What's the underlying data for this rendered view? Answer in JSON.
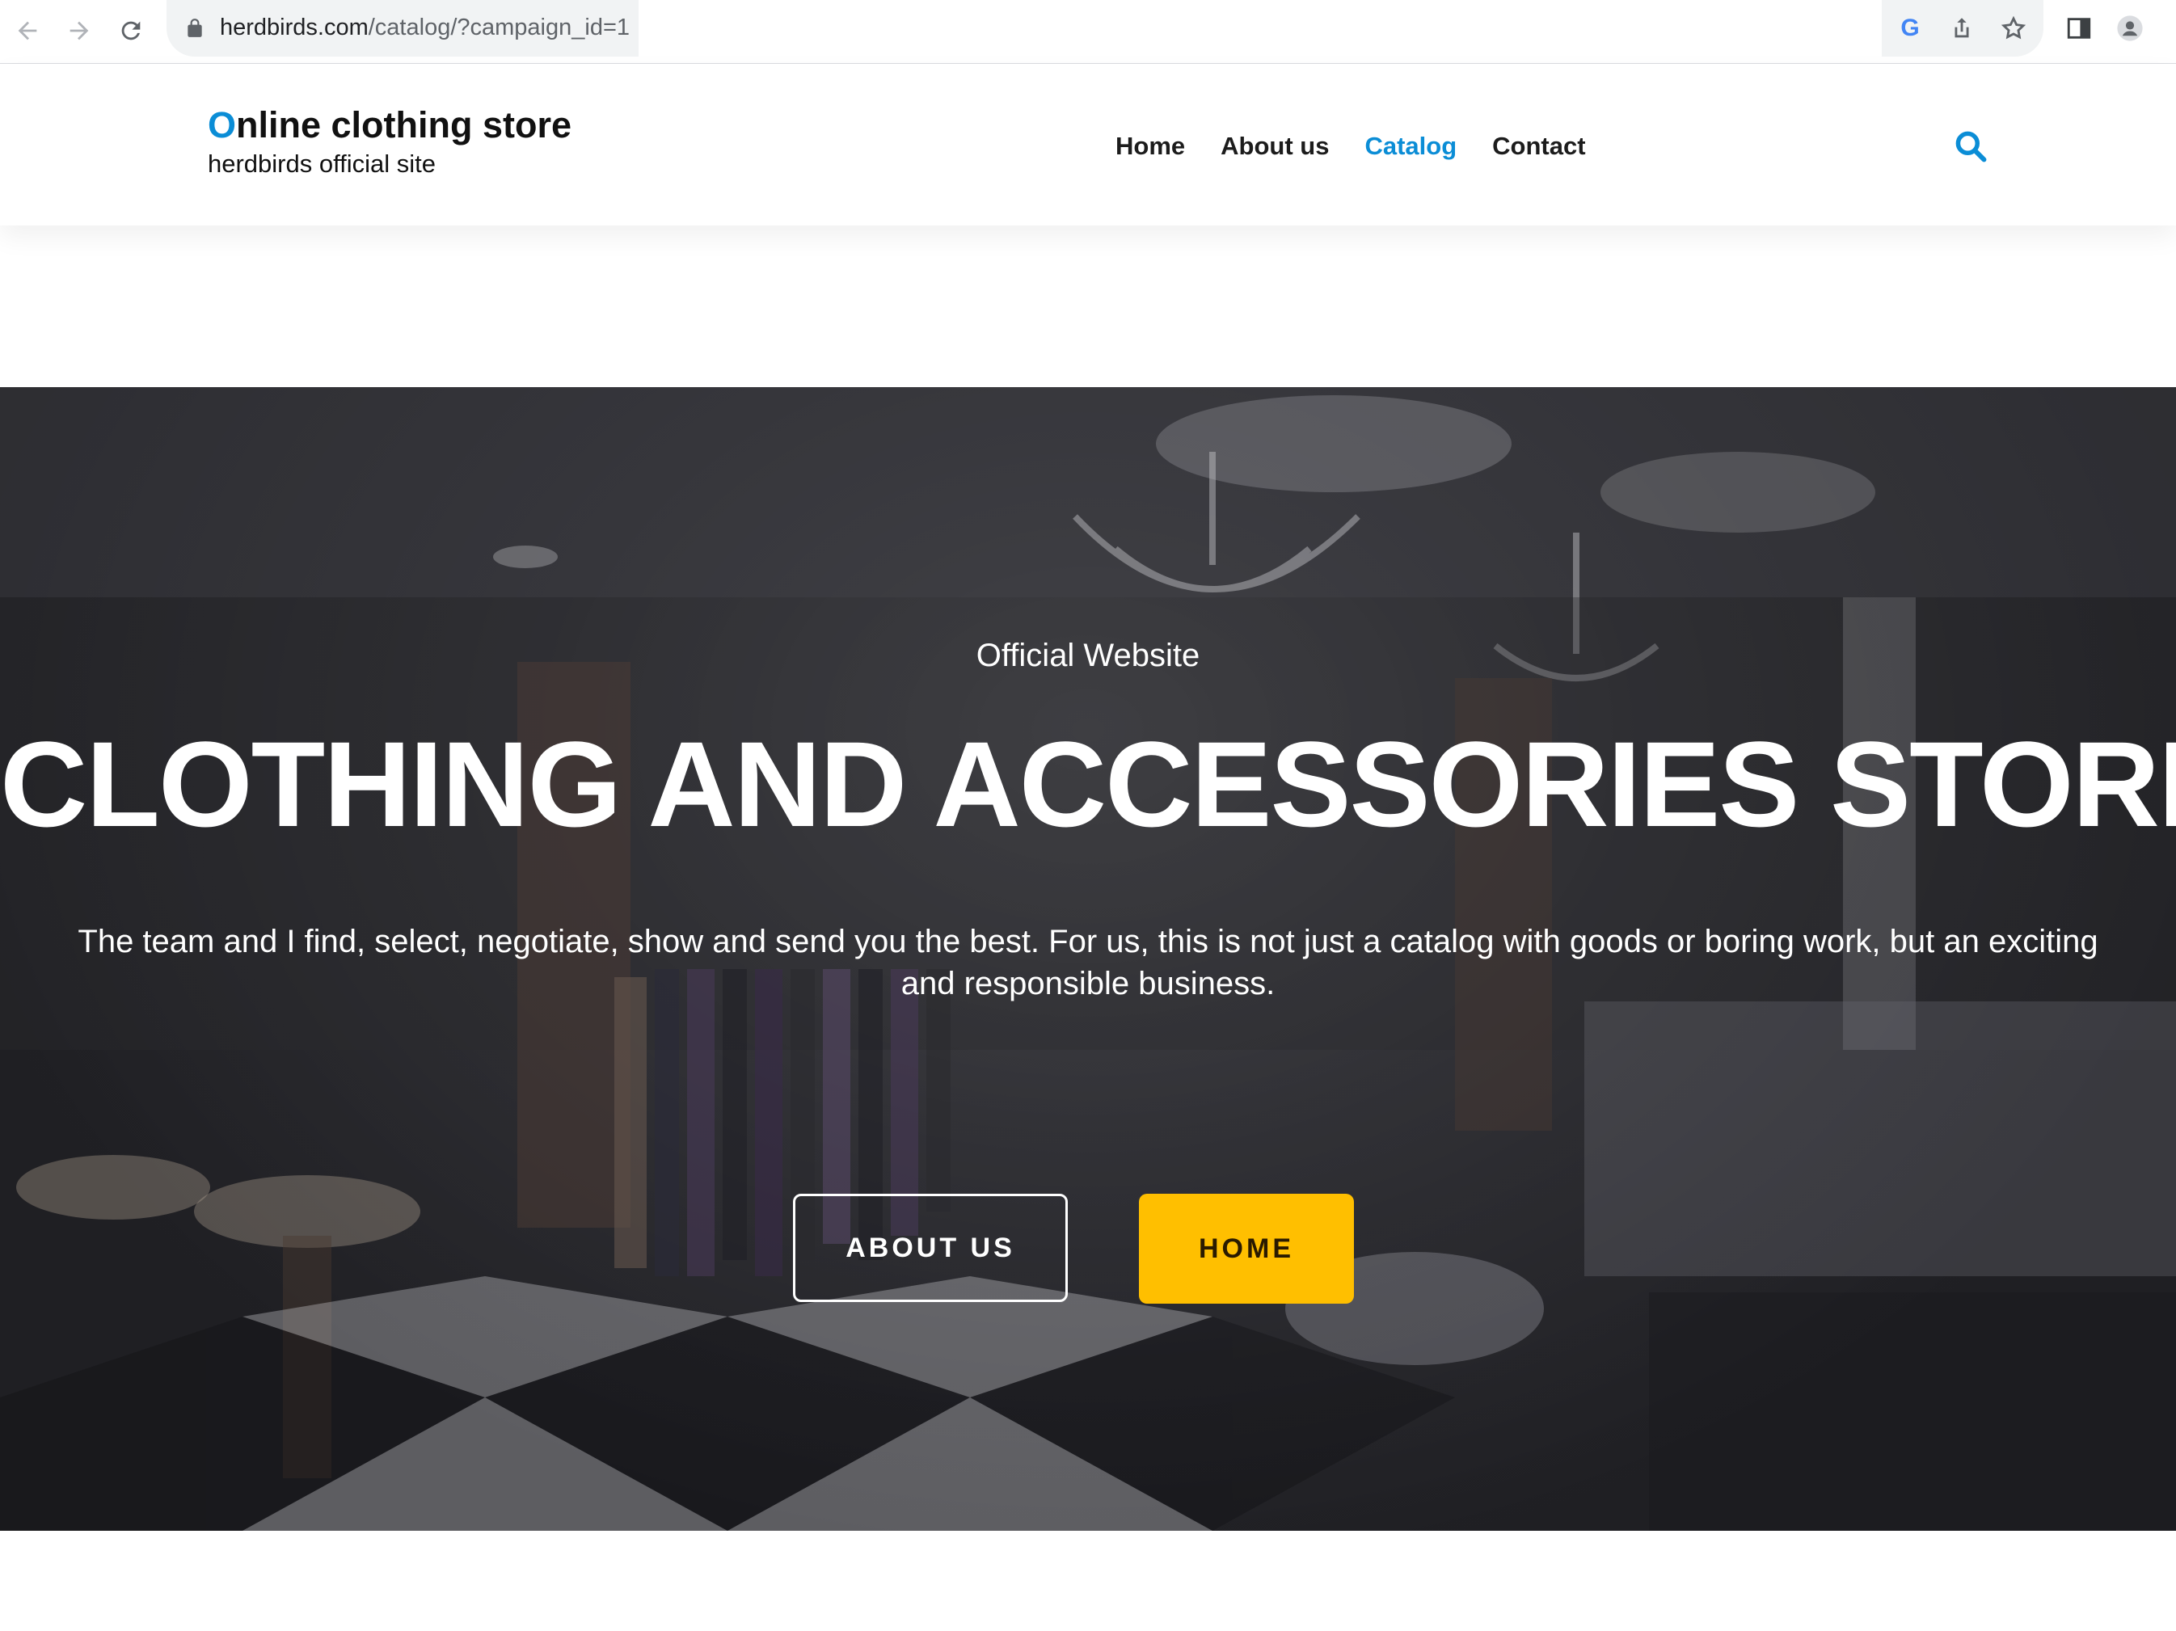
{
  "browser": {
    "url_host": "herdbirds.com",
    "url_path": "/catalog/?campaign_id=1",
    "google_icon_letter": "G",
    "icons": [
      "back-arrow-icon",
      "forward-arrow-icon",
      "reload-icon",
      "lock-icon",
      "google-icon",
      "share-icon",
      "star-icon",
      "side-panel-icon",
      "profile-icon"
    ]
  },
  "header": {
    "brand_first_letter": "O",
    "brand_rest": "nline clothing store",
    "brand_subtitle": "herdbirds official site",
    "nav": [
      {
        "label": "Home"
      },
      {
        "label": "About us"
      },
      {
        "label": "Catalog",
        "active": true
      },
      {
        "label": "Contact"
      }
    ],
    "accent_color": "#0b8dd6"
  },
  "hero": {
    "kicker": "Official Website",
    "title": "CLOTHING AND ACCESSORIES STORE",
    "description": "The team and I find, select, negotiate, show and send you the best. For us, this is not just a catalog with goods or boring work, but an exciting and responsible business.",
    "buttons": {
      "about_label": "ABOUT US",
      "home_label": "HOME",
      "home_color": "#ffbf00"
    }
  }
}
